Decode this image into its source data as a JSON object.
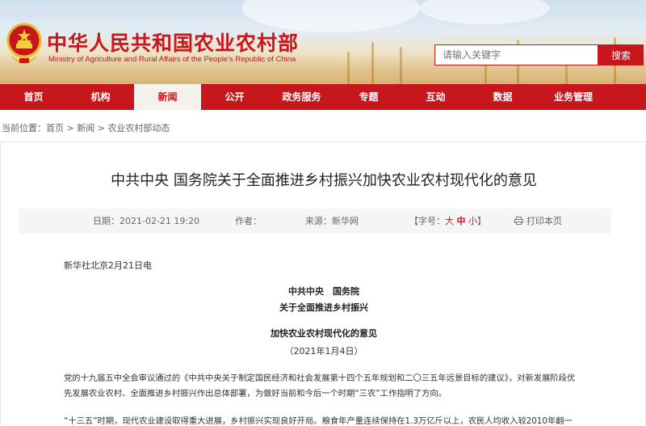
{
  "header": {
    "site_title": "中华人民共和国农业农村部",
    "site_subtitle": "Ministry of Agriculture and Rural Affairs of the People's Republic of China",
    "search_placeholder": "请输入关键字",
    "search_button": "搜索",
    "brand_color": "#c8161d"
  },
  "nav": {
    "items": [
      {
        "label": "首页"
      },
      {
        "label": "机构"
      },
      {
        "label": "新闻",
        "active": true
      },
      {
        "label": "公开"
      },
      {
        "label": "政务服务"
      },
      {
        "label": "专题"
      },
      {
        "label": "互动"
      },
      {
        "label": "数据"
      },
      {
        "label": "业务管理"
      }
    ]
  },
  "breadcrumb": {
    "prefix": "当前位置：",
    "items": [
      "首页",
      "新闻",
      "农业农村部动态"
    ],
    "separator": " > "
  },
  "article": {
    "title": "中共中央 国务院关于全面推进乡村振兴加快农业农村现代化的意见",
    "meta": {
      "date_label": "日期：",
      "date": "2021-02-21 19:20",
      "author_label": "作者：",
      "author": "",
      "source_label": "来源：",
      "source": "新华网",
      "font_label": "【字号：",
      "font_large": "大",
      "font_medium": "中",
      "font_small": "小",
      "font_close": "】",
      "print": "打印本页"
    },
    "dateline": "新华社北京2月21日电",
    "issuer": "中共中央　国务院",
    "doc_title_line1": "关于全面推进乡村振兴",
    "doc_title_line2": "加快农业农村现代化的意见",
    "doc_date": "（2021年1月4日）",
    "para1_line1": "党的十九届五中全会审议通过的《中共中央关于制定国民经济和社会发展第十四个五年规划和二〇三五年远景目标的建议》，对新发展阶段优",
    "para1_line2": "先发展农业农村、全面推进乡村振兴作出总体部署，为做好当前和今后一个时期“三农”工作指明了方向。",
    "para2_line1": "“十三五”时期，现代农业建设取得重大进展，乡村振兴实现良好开局。粮食年产量连续保持在1.3万亿斤以上，农民人均收入较2010年翻一"
  }
}
